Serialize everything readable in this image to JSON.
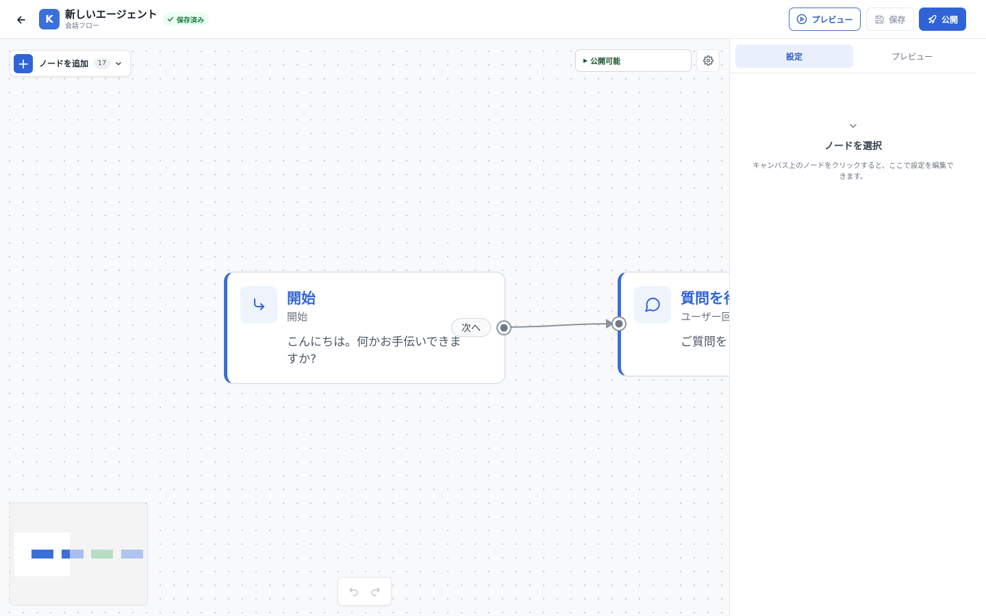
{
  "header": {
    "back_icon": "arrow-left-icon",
    "app_initial": "K",
    "title": "新しいエージェント",
    "subtitle": "会話フロー",
    "saved_badge": "保存済み",
    "preview_label": "プレビュー",
    "save_label": "保存",
    "publish_label": "公開"
  },
  "toolbar": {
    "add_node_label": "ノードを追加",
    "node_count": "17",
    "publish_status": "公開可能"
  },
  "nodes": [
    {
      "title": "開始",
      "type": "開始",
      "message": "こんにちは。何かお手伝いできますか?",
      "icon": "corner-down-right-icon"
    },
    {
      "title": "質問を待",
      "type": "ユーザー回",
      "message": "ご質問をどうぞ",
      "icon": "message-circle-icon"
    }
  ],
  "edge": {
    "label": "次へ"
  },
  "panel": {
    "tab_settings": "設定",
    "tab_preview": "プレビュー",
    "empty_title": "ノードを選択",
    "empty_desc": "キャンバス上のノードをクリックすると、ここで設定を編集できます。"
  },
  "colors": {
    "accent": "#2f63d6",
    "success": "#15803d",
    "canvas_bg": "#f8f9fb"
  }
}
